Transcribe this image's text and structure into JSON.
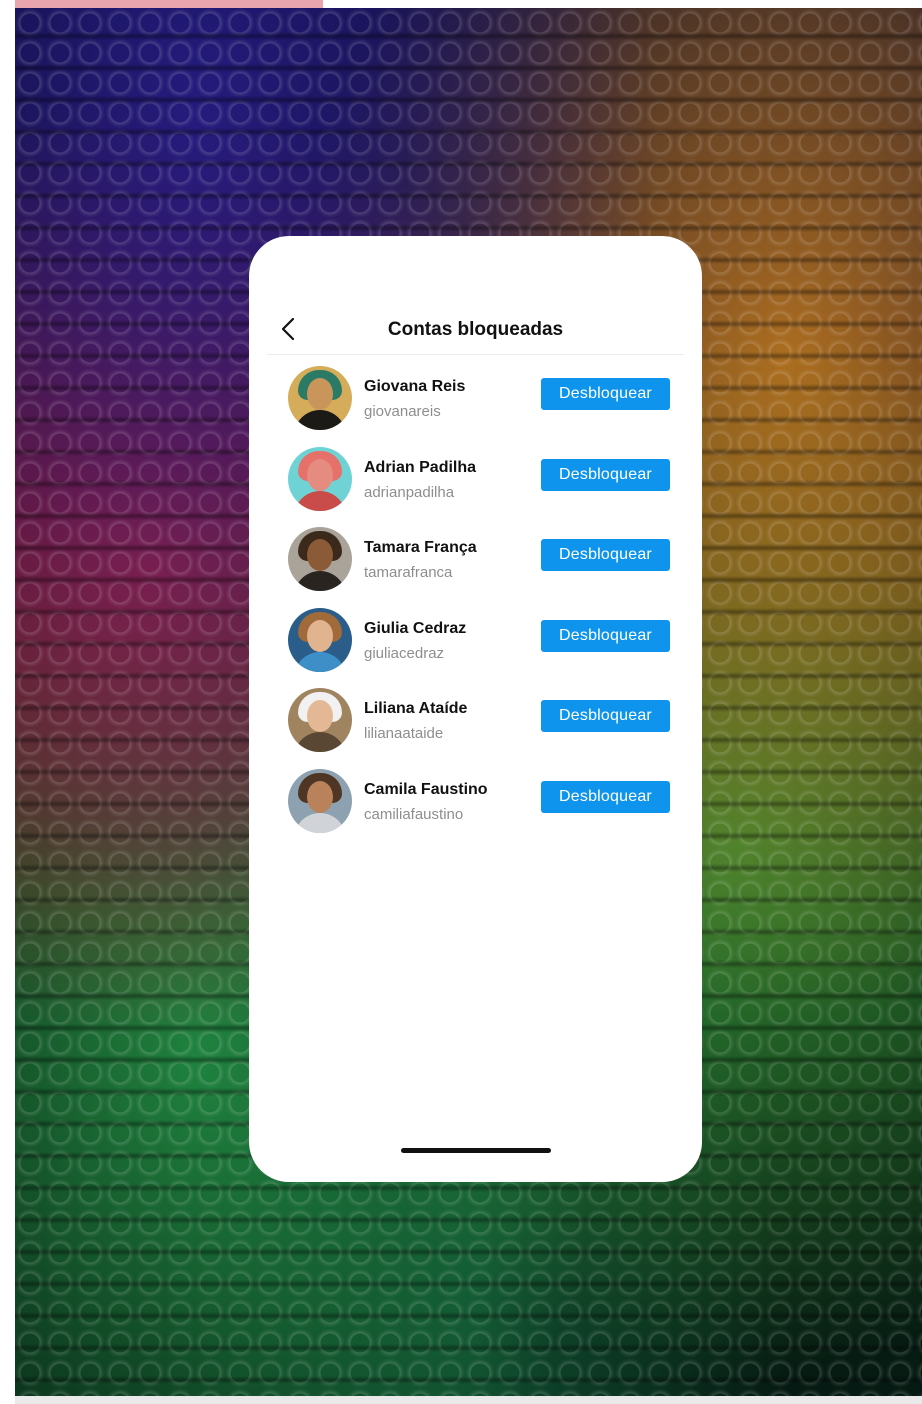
{
  "header": {
    "title": "Contas bloqueadas"
  },
  "colors": {
    "accent": "#0f94ee",
    "pink_strip": "#e8a5ad"
  },
  "icons": {
    "back": "chevron-left-icon"
  },
  "blocked_accounts": [
    {
      "name": "Giovana Reis",
      "handle": "giovanareis",
      "button": "Desbloquear",
      "avatar_colors": {
        "bg": "#d5ad5a",
        "hair": "#2b7a66",
        "face": "#c9955b",
        "body": "#1c1a16"
      }
    },
    {
      "name": "Adrian Padilha",
      "handle": "adrianpadilha",
      "button": "Desbloquear",
      "avatar_colors": {
        "bg": "#6fd3d6",
        "hair": "#e6706a",
        "face": "#e58b7f",
        "body": "#c94b4a"
      }
    },
    {
      "name": "Tamara França",
      "handle": "tamarafranca",
      "button": "Desbloquear",
      "avatar_colors": {
        "bg": "#a9a39a",
        "hair": "#3b2a1c",
        "face": "#8b5a36",
        "body": "#2a2420"
      }
    },
    {
      "name": "Giulia Cedraz",
      "handle": "giuliacedraz",
      "button": "Desbloquear",
      "avatar_colors": {
        "bg": "#2a5d8a",
        "hair": "#a06a3a",
        "face": "#e2b38f",
        "body": "#3e8fc8"
      }
    },
    {
      "name": "Liliana Ataíde",
      "handle": "lilianaataide",
      "button": "Desbloquear",
      "avatar_colors": {
        "bg": "#a0845f",
        "hair": "#f1f1f1",
        "face": "#e4b894",
        "body": "#5a4733"
      }
    },
    {
      "name": "Camila Faustino",
      "handle": "camiliafaustino",
      "button": "Desbloquear",
      "avatar_colors": {
        "bg": "#8da1b0",
        "hair": "#4e3524",
        "face": "#b9825a",
        "body": "#d0d4d8"
      }
    }
  ]
}
